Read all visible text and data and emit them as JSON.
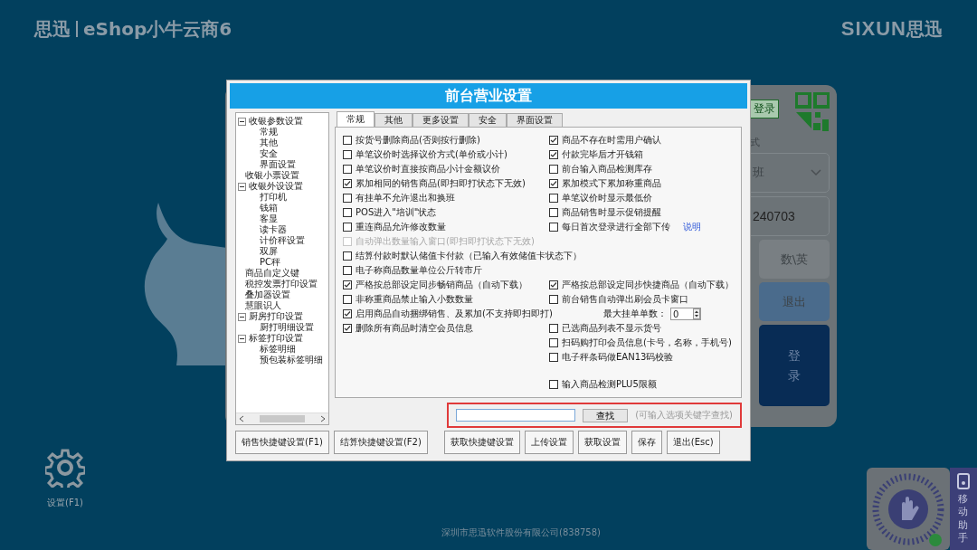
{
  "header": {
    "logo": "思迅",
    "product": "eShop小牛云商6",
    "brand_latin": "SIXUN",
    "brand_cn": "思迅"
  },
  "login_card": {
    "tag": "登录",
    "label": "式",
    "shift": "班",
    "field_value": "240703",
    "keys": [
      {
        "label": "数\\英",
        "kind": "plain"
      },
      {
        "label": "退出",
        "kind": "accent"
      }
    ],
    "login_button": "登录"
  },
  "settings_button": "设置(F1)",
  "footer": "深圳市思迅软件股份有限公司(838758)",
  "mobile_helper": "移动助手",
  "dialog": {
    "title": "前台营业设置",
    "tree": [
      {
        "label": "收银参数设置",
        "expanded": true,
        "children": [
          {
            "label": "常规"
          },
          {
            "label": "其他"
          },
          {
            "label": "安全"
          },
          {
            "label": "界面设置"
          }
        ]
      },
      {
        "label": "收银小票设置"
      },
      {
        "label": "收银外设设置",
        "expanded": true,
        "children": [
          {
            "label": "打印机"
          },
          {
            "label": "钱箱"
          },
          {
            "label": "客显"
          },
          {
            "label": "读卡器"
          },
          {
            "label": "计价秤设置"
          },
          {
            "label": "双屏"
          },
          {
            "label": "PC秤"
          }
        ]
      },
      {
        "label": "商品自定义键"
      },
      {
        "label": "税控发票打印设置"
      },
      {
        "label": "叠加器设置"
      },
      {
        "label": "慧眼识人"
      },
      {
        "label": "厨房打印设置",
        "expanded": true,
        "children": [
          {
            "label": "厨打明细设置"
          }
        ]
      },
      {
        "label": "标签打印设置",
        "expanded": true,
        "children": [
          {
            "label": "标签明细"
          },
          {
            "label": "预包装标签明细"
          }
        ]
      }
    ],
    "tabs": [
      {
        "label": "常规",
        "selected": true
      },
      {
        "label": "其他",
        "selected": false
      },
      {
        "label": "更多设置",
        "selected": false
      },
      {
        "label": "安全",
        "selected": false
      },
      {
        "label": "界面设置",
        "selected": false
      }
    ],
    "rows": [
      {
        "left": {
          "kind": "checkbox",
          "label": "按货号删除商品(否则按行删除)",
          "checked": false,
          "disabled": false
        },
        "right": {
          "kind": "checkbox",
          "label": "商品不存在时需用户确认",
          "checked": true,
          "disabled": false
        }
      },
      {
        "left": {
          "kind": "checkbox",
          "label": "单笔议价时选择议价方式(单价或小计)",
          "checked": false,
          "disabled": false
        },
        "right": {
          "kind": "checkbox",
          "label": "付款完毕后才开钱箱",
          "checked": true,
          "disabled": false
        }
      },
      {
        "left": {
          "kind": "checkbox",
          "label": "单笔议价时直接按商品小计金额议价",
          "checked": false,
          "disabled": false
        },
        "right": {
          "kind": "checkbox",
          "label": "前台输入商品检测库存",
          "checked": false,
          "disabled": false
        }
      },
      {
        "left": {
          "kind": "checkbox",
          "label": "累加相同的销售商品(即扫即打状态下无效)",
          "checked": true,
          "disabled": false
        },
        "right": {
          "kind": "checkbox",
          "label": "累加模式下累加称重商品",
          "checked": true,
          "disabled": false
        }
      },
      {
        "left": {
          "kind": "checkbox",
          "label": "有挂单不允许退出和换班",
          "checked": false,
          "disabled": false
        },
        "right": {
          "kind": "checkbox",
          "label": "单笔议价时显示最低价",
          "checked": false,
          "disabled": false
        }
      },
      {
        "left": {
          "kind": "checkbox",
          "label": "POS进入\"培训\"状态",
          "checked": false,
          "disabled": false
        },
        "right": {
          "kind": "checkbox",
          "label": "商品销售时显示促销提醒",
          "checked": false,
          "disabled": false
        }
      },
      {
        "left": {
          "kind": "checkbox",
          "label": "重连商品允许修改数量",
          "checked": false,
          "disabled": false
        },
        "right": {
          "kind": "checkbox",
          "label": "每日首次登录进行全部下传",
          "checked": false,
          "disabled": false,
          "link": "说明"
        }
      },
      {
        "left": {
          "kind": "checkbox",
          "label": "自动弹出数量输入窗口(即扫即打状态下无效)",
          "checked": false,
          "disabled": true
        }
      },
      {
        "left": {
          "kind": "checkbox",
          "label": "结算付款时默认储值卡付款（已输入有效储值卡状态下）",
          "checked": false,
          "disabled": false
        }
      },
      {
        "left": {
          "kind": "checkbox",
          "label": "电子称商品数量单位公斤转市斤",
          "checked": false,
          "disabled": false
        }
      },
      {
        "left": {
          "kind": "checkbox",
          "label": "严格按总部设定同步畅销商品（自动下载）",
          "checked": true,
          "disabled": false
        },
        "right": {
          "kind": "checkbox",
          "label": "严格按总部设定同步快捷商品（自动下载）",
          "checked": true,
          "disabled": false
        }
      },
      {
        "left": {
          "kind": "checkbox",
          "label": "非称重商品禁止输入小数数量",
          "checked": false,
          "disabled": false
        },
        "right": {
          "kind": "checkbox",
          "label": "前台销售自动弹出刷会员卡窗口",
          "checked": false,
          "disabled": false
        }
      },
      {
        "left": {
          "kind": "checkbox",
          "label": "启用商品自动捆绑销售、及累加(不支持即扫即打)",
          "checked": true,
          "disabled": false
        },
        "right": {
          "kind": "number",
          "label": "最大挂单单数：",
          "value": "0"
        }
      },
      {
        "left": {
          "kind": "checkbox",
          "label": "删除所有商品时清空会员信息",
          "checked": true,
          "disabled": false
        },
        "right": {
          "kind": "checkbox",
          "label": "已选商品列表不显示货号",
          "checked": false,
          "disabled": false
        }
      },
      {
        "right": {
          "kind": "checkbox",
          "label": "扫码购打印会员信息(卡号，名称，手机号)",
          "checked": false,
          "disabled": false
        }
      },
      {
        "right": {
          "kind": "checkbox",
          "label": "电子秤条码做EAN13码校验",
          "checked": false,
          "disabled": false
        }
      },
      {
        "right": {
          "kind": "checkbox",
          "label": "输入商品检测PLU5限额",
          "checked": false,
          "disabled": false
        }
      }
    ],
    "search": {
      "button": "查找",
      "hint": "(可输入选项关键字查找)"
    },
    "buttons_left": [
      "销售快捷键设置(F1)",
      "结算快捷键设置(F2)"
    ],
    "buttons_right": [
      "获取快捷键设置",
      "上传设置",
      "获取设置",
      "保存",
      "退出(Esc)"
    ]
  }
}
